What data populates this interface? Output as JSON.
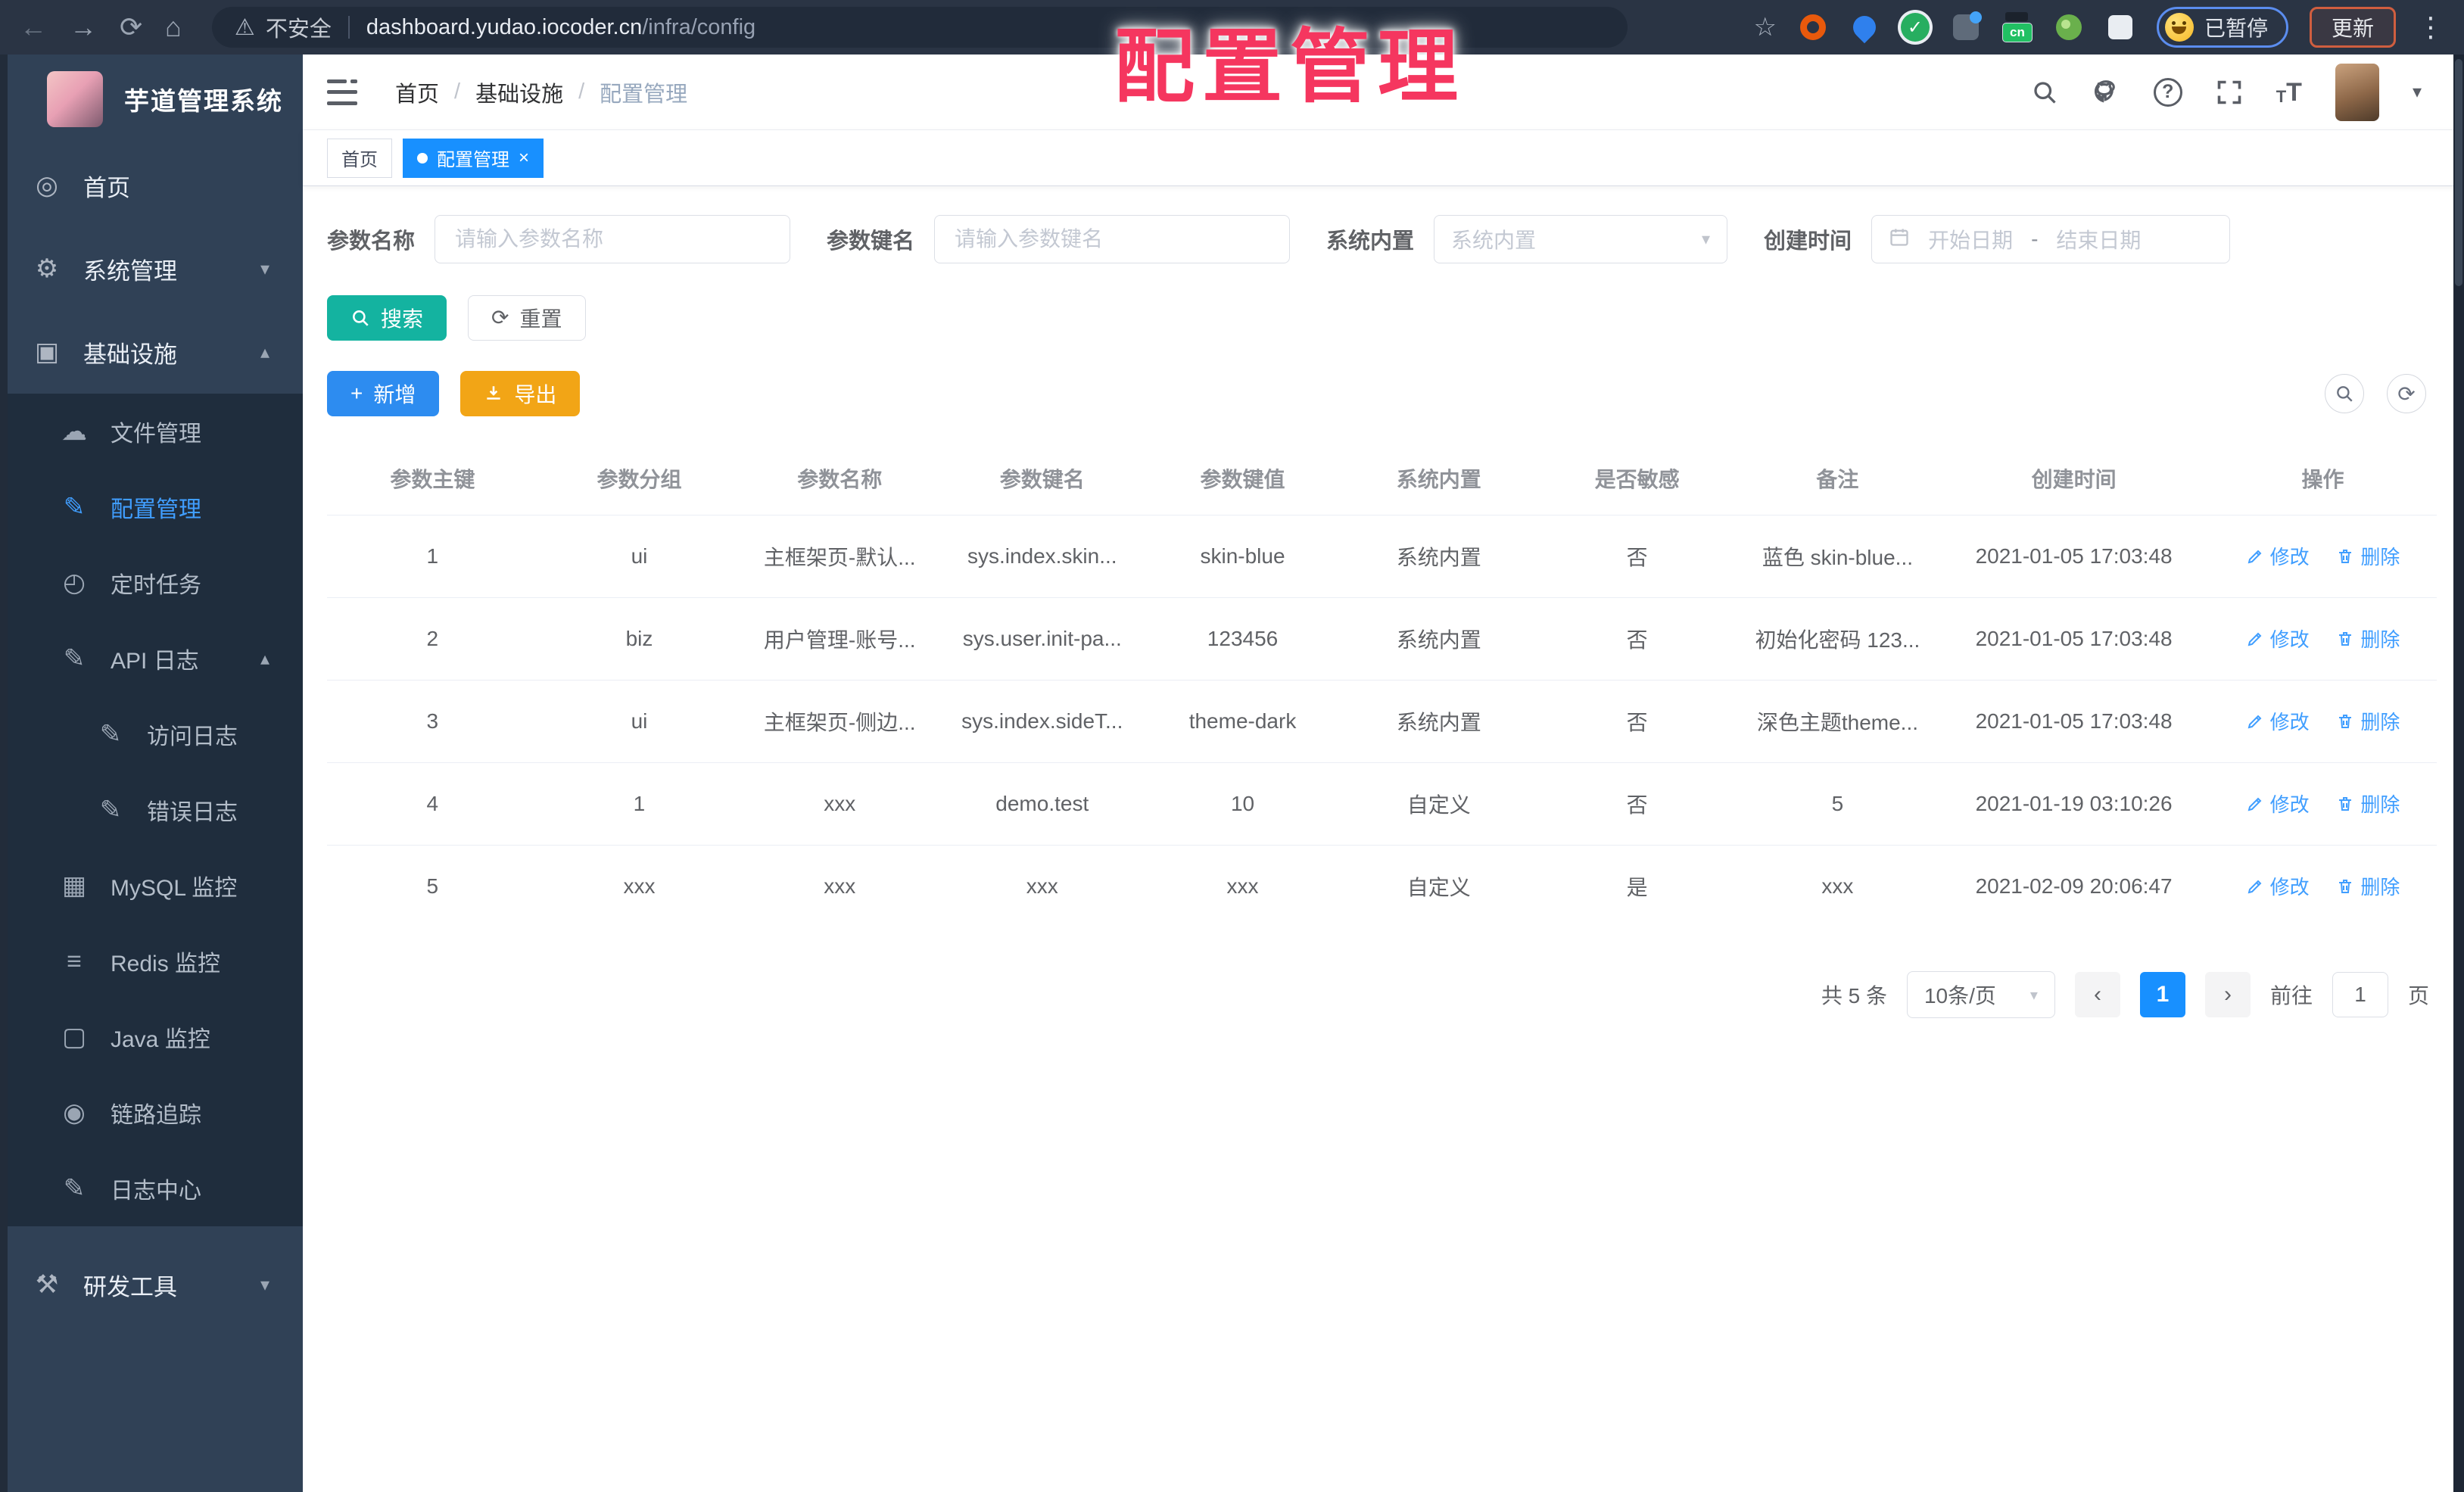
{
  "browser": {
    "nav": {
      "back": "←",
      "forward": "→",
      "reload": "⟳",
      "home": "⌂"
    },
    "security_icon": "⚠",
    "security_label": "不安全",
    "url_host": "dashboard.yudao.iocoder.cn",
    "url_path": "/infra/config",
    "bookmark_star": "☆",
    "cn_badge": "cn",
    "check_glyph": "✓",
    "paused_badge": "已暂停",
    "update_button": "更新",
    "menu_dots": "⋮"
  },
  "overlay": {
    "title": "配置管理",
    "color": "#f5365f"
  },
  "sidebar": {
    "app_title": "芋道管理系统",
    "menu": [
      {
        "label": "首页",
        "icon": "dashboard-icon",
        "glyph": "◎",
        "level": "l1",
        "state": "",
        "chevron": ""
      },
      {
        "label": "系统管理",
        "icon": "gear-icon",
        "glyph": "⚙",
        "level": "l1",
        "state": "",
        "chevron": "▾"
      },
      {
        "label": "基础设施",
        "icon": "infrastructure-icon",
        "glyph": "▣",
        "level": "l1",
        "state": "open",
        "chevron": "▴"
      },
      {
        "label": "文件管理",
        "icon": "cloud-upload-icon",
        "glyph": "☁",
        "level": "l2",
        "state": "",
        "chevron": ""
      },
      {
        "label": "配置管理",
        "icon": "config-edit-icon",
        "glyph": "✎",
        "level": "l2",
        "state": "active",
        "chevron": ""
      },
      {
        "label": "定时任务",
        "icon": "timer-icon",
        "glyph": "◴",
        "level": "l2",
        "state": "",
        "chevron": ""
      },
      {
        "label": "API 日志",
        "icon": "api-log-icon",
        "glyph": "✎",
        "level": "l2",
        "state": "",
        "chevron": "▴"
      },
      {
        "label": "访问日志",
        "icon": "access-log-icon",
        "glyph": "✎",
        "level": "l3",
        "state": "",
        "chevron": ""
      },
      {
        "label": "错误日志",
        "icon": "error-log-icon",
        "glyph": "✎",
        "level": "l3",
        "state": "",
        "chevron": ""
      },
      {
        "label": "MySQL 监控",
        "icon": "mysql-monitor-icon",
        "glyph": "▦",
        "level": "l2",
        "state": "",
        "chevron": ""
      },
      {
        "label": "Redis 监控",
        "icon": "redis-monitor-icon",
        "glyph": "≡",
        "level": "l2",
        "state": "",
        "chevron": ""
      },
      {
        "label": "Java 监控",
        "icon": "java-monitor-icon",
        "glyph": "▢",
        "level": "l2",
        "state": "",
        "chevron": ""
      },
      {
        "label": "链路追踪",
        "icon": "trace-eye-icon",
        "glyph": "◉",
        "level": "l2",
        "state": "",
        "chevron": ""
      },
      {
        "label": "日志中心",
        "icon": "log-center-icon",
        "glyph": "✎",
        "level": "l2",
        "state": "",
        "chevron": ""
      },
      {
        "label": "研发工具",
        "icon": "dev-tools-icon",
        "glyph": "⚒",
        "level": "l1 last",
        "state": "",
        "chevron": "▾"
      }
    ]
  },
  "navbar": {
    "breadcrumb": [
      {
        "text": "首页",
        "cls": "link"
      },
      {
        "text": "/",
        "cls": "sep"
      },
      {
        "text": "基础设施",
        "cls": "link"
      },
      {
        "text": "/",
        "cls": "sep"
      },
      {
        "text": "配置管理",
        "cls": "last"
      }
    ],
    "caret": "▾"
  },
  "tags": [
    {
      "label": "首页",
      "state": "",
      "close": ""
    },
    {
      "label": "配置管理",
      "state": "active",
      "close": "×"
    }
  ],
  "search_form": {
    "name_label": "参数名称",
    "name_placeholder": "请输入参数名称",
    "key_label": "参数键名",
    "key_placeholder": "请输入参数键名",
    "type_label": "系统内置",
    "type_placeholder": "系统内置",
    "select_chevron": "▾",
    "date_label": "创建时间",
    "date_start_placeholder": "开始日期",
    "date_separator": "-",
    "date_end_placeholder": "结束日期",
    "search_button": "搜索",
    "reset_button": "重置",
    "reset_glyph": "⟳"
  },
  "toolbar": {
    "add_button": "新增",
    "add_glyph": "+",
    "export_button": "导出",
    "refresh_glyph": "⟳"
  },
  "table": {
    "columns": [
      "参数主键",
      "参数分组",
      "参数名称",
      "参数键名",
      "参数键值",
      "系统内置",
      "是否敏感",
      "备注",
      "创建时间",
      "操作"
    ],
    "action_edit": "修改",
    "action_delete": "删除",
    "rows": [
      {
        "cells": [
          "1",
          "ui",
          "主框架页-默认...",
          "sys.index.skin...",
          "skin-blue",
          "系统内置",
          "否",
          "蓝色 skin-blue...",
          "2021-01-05 17:03:48"
        ]
      },
      {
        "cells": [
          "2",
          "biz",
          "用户管理-账号...",
          "sys.user.init-pa...",
          "123456",
          "系统内置",
          "否",
          "初始化密码 123...",
          "2021-01-05 17:03:48"
        ]
      },
      {
        "cells": [
          "3",
          "ui",
          "主框架页-侧边...",
          "sys.index.sideT...",
          "theme-dark",
          "系统内置",
          "否",
          "深色主题theme...",
          "2021-01-05 17:03:48"
        ]
      },
      {
        "cells": [
          "4",
          "1",
          "xxx",
          "demo.test",
          "10",
          "自定义",
          "否",
          "5",
          "2021-01-19 03:10:26"
        ]
      },
      {
        "cells": [
          "5",
          "xxx",
          "xxx",
          "xxx",
          "xxx",
          "自定义",
          "是",
          "xxx",
          "2021-02-09 20:06:47"
        ]
      }
    ]
  },
  "pagination": {
    "total": "共 5 条",
    "page_size": "10条/页",
    "size_chevron": "▾",
    "prev": "‹",
    "current": "1",
    "next": "›",
    "goto_label": "前往",
    "goto_value": "1",
    "unit_label": "页"
  }
}
